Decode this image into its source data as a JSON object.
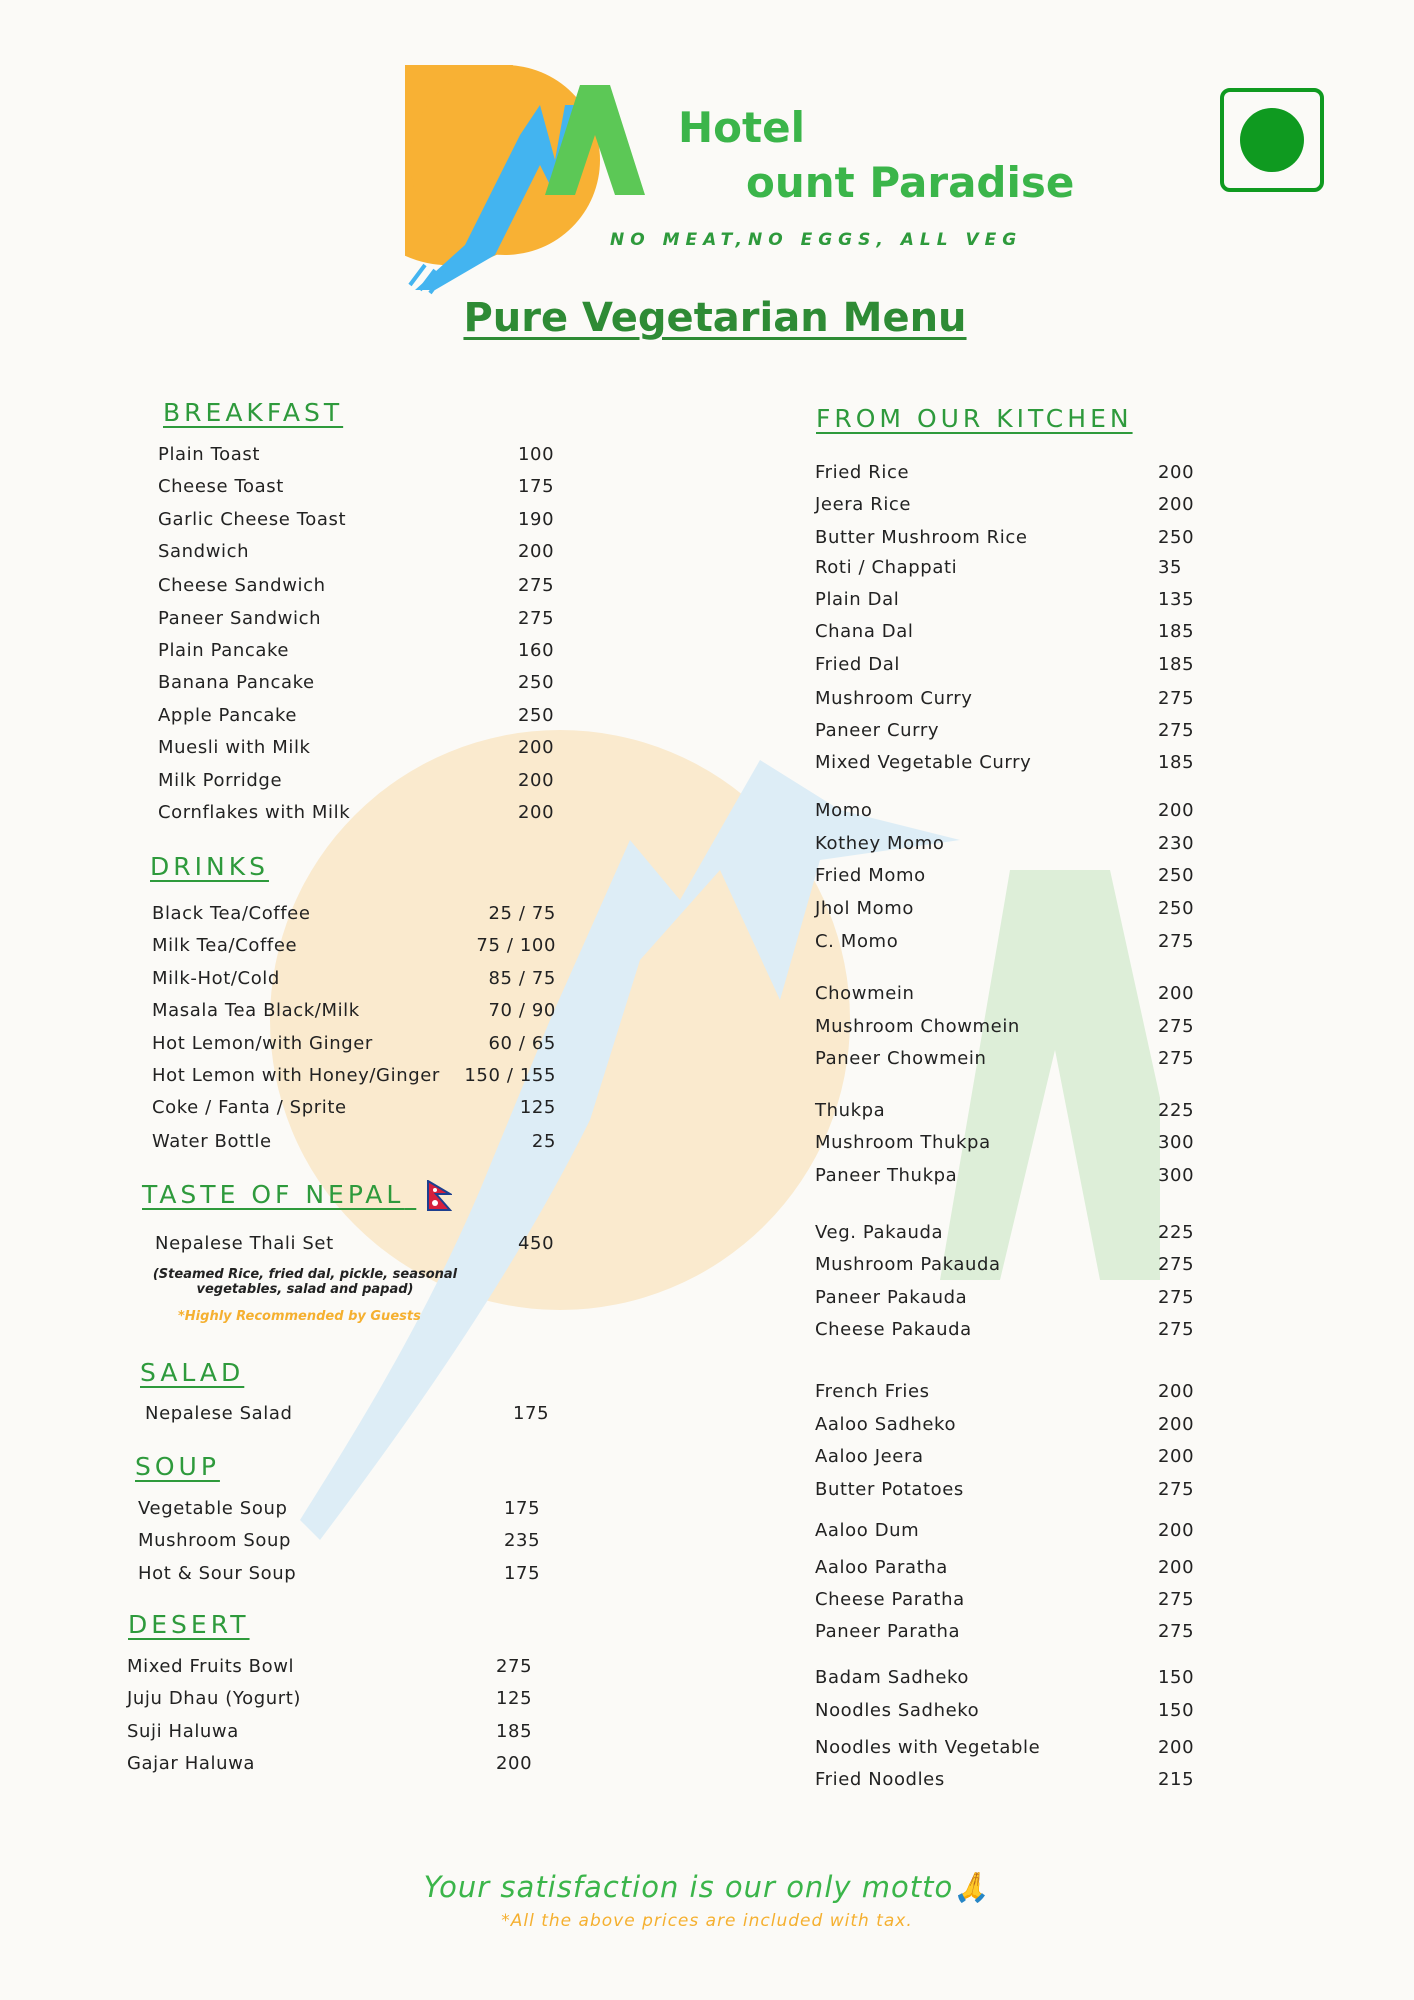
{
  "brand": {
    "hotel": "Hotel",
    "name": "ount Paradise",
    "tagline": "NO MEAT,NO EGGS, ALL VEG",
    "logo_letter": "M"
  },
  "colors": {
    "green": "#3bb54a",
    "dark_green": "#2e8b35",
    "orange": "#f5b030",
    "blue": "#5ab4f0",
    "veg_mark": "#0f9a20"
  },
  "title": "Pure Vegetarian Menu",
  "left": {
    "breakfast": {
      "heading": "BREAKFAST",
      "items": [
        {
          "name": "Plain Toast",
          "price": "100"
        },
        {
          "name": "Cheese Toast",
          "price": "175"
        },
        {
          "name": "Garlic Cheese Toast",
          "price": "190"
        },
        {
          "name": "Sandwich",
          "price": "200"
        },
        {
          "name": "Cheese Sandwich",
          "price": "275"
        },
        {
          "name": "Paneer Sandwich",
          "price": "275"
        },
        {
          "name": "Plain Pancake",
          "price": "160"
        },
        {
          "name": "Banana Pancake",
          "price": "250"
        },
        {
          "name": "Apple Pancake",
          "price": "250"
        },
        {
          "name": "Muesli with Milk",
          "price": "200"
        },
        {
          "name": "Milk Porridge",
          "price": "200"
        },
        {
          "name": "Cornflakes with Milk",
          "price": "200"
        }
      ]
    },
    "drinks": {
      "heading": "DRINKS",
      "items": [
        {
          "name": "Black Tea/Coffee",
          "price": "25 / 75"
        },
        {
          "name": "Milk Tea/Coffee",
          "price": "75 / 100"
        },
        {
          "name": "Milk-Hot/Cold",
          "price": "85 / 75"
        },
        {
          "name": "Masala Tea Black/Milk",
          "price": "70 / 90"
        },
        {
          "name": "Hot Lemon/with Ginger",
          "price": "60 / 65"
        },
        {
          "name": "Hot Lemon with Honey/Ginger",
          "price": "150 / 155"
        },
        {
          "name": "Coke / Fanta / Sprite",
          "price": "125"
        },
        {
          "name": "Water Bottle",
          "price": "25"
        }
      ]
    },
    "nepal": {
      "heading": "TASTE OF NEPAL",
      "items": [
        {
          "name": "Nepalese Thali Set",
          "price": "450"
        }
      ],
      "note_line1": "(Steamed Rice, fried dal, pickle, seasonal",
      "note_line2": "vegetables, salad and papad)",
      "recommended": "*Highly Recommended by Guests"
    },
    "salad": {
      "heading": "SALAD",
      "items": [
        {
          "name": "Nepalese Salad",
          "price": "175"
        }
      ]
    },
    "soup": {
      "heading": "SOUP",
      "items": [
        {
          "name": "Vegetable Soup",
          "price": "175"
        },
        {
          "name": "Mushroom Soup",
          "price": "235"
        },
        {
          "name": "Hot & Sour Soup",
          "price": "175"
        }
      ]
    },
    "desert": {
      "heading": "DESERT",
      "items": [
        {
          "name": "Mixed Fruits Bowl",
          "price": "275"
        },
        {
          "name": "Juju Dhau (Yogurt)",
          "price": "125"
        },
        {
          "name": "Suji Haluwa",
          "price": "185"
        },
        {
          "name": "Gajar Haluwa",
          "price": "200"
        }
      ]
    }
  },
  "right": {
    "heading": "FROM OUR KITCHEN",
    "items": [
      {
        "name": "Fried Rice",
        "price": "200"
      },
      {
        "name": "Jeera Rice",
        "price": "200"
      },
      {
        "name": "Butter Mushroom Rice",
        "price": "250"
      },
      {
        "name": "Roti / Chappati",
        "price": "35"
      },
      {
        "name": "Plain Dal",
        "price": "135"
      },
      {
        "name": "Chana Dal",
        "price": "185"
      },
      {
        "name": "Fried Dal",
        "price": "185"
      },
      {
        "name": "Mushroom Curry",
        "price": "275"
      },
      {
        "name": "Paneer Curry",
        "price": "275"
      },
      {
        "name": "Mixed Vegetable Curry",
        "price": "185"
      },
      {
        "name": "Momo",
        "price": "200"
      },
      {
        "name": "Kothey Momo",
        "price": "230"
      },
      {
        "name": "Fried Momo",
        "price": "250"
      },
      {
        "name": "Jhol Momo",
        "price": "250"
      },
      {
        "name": "C. Momo",
        "price": "275"
      },
      {
        "name": "Chowmein",
        "price": "200"
      },
      {
        "name": "Mushroom Chowmein",
        "price": "275"
      },
      {
        "name": "Paneer Chowmein",
        "price": "275"
      },
      {
        "name": "Thukpa",
        "price": "225"
      },
      {
        "name": "Mushroom Thukpa",
        "price": "300"
      },
      {
        "name": "Paneer Thukpa",
        "price": "300"
      },
      {
        "name": "Veg. Pakauda",
        "price": "225"
      },
      {
        "name": "Mushroom Pakauda",
        "price": "275"
      },
      {
        "name": "Paneer Pakauda",
        "price": "275"
      },
      {
        "name": "Cheese Pakauda",
        "price": "275"
      },
      {
        "name": "French Fries",
        "price": "200"
      },
      {
        "name": "Aaloo Sadheko",
        "price": "200"
      },
      {
        "name": "Aaloo Jeera",
        "price": "200"
      },
      {
        "name": "Butter Potatoes",
        "price": "275"
      },
      {
        "name": "Aaloo Dum",
        "price": "200"
      },
      {
        "name": "Aaloo Paratha",
        "price": "200"
      },
      {
        "name": "Cheese Paratha",
        "price": "275"
      },
      {
        "name": "Paneer Paratha",
        "price": "275"
      },
      {
        "name": "Badam Sadheko",
        "price": "150"
      },
      {
        "name": "Noodles Sadheko",
        "price": "150"
      },
      {
        "name": "Noodles with Vegetable",
        "price": "200"
      },
      {
        "name": "Fried Noodles",
        "price": "215"
      }
    ]
  },
  "footer": {
    "motto": "Your satisfaction is our only motto🙏",
    "tax_note": "*All the above prices are included with tax."
  }
}
